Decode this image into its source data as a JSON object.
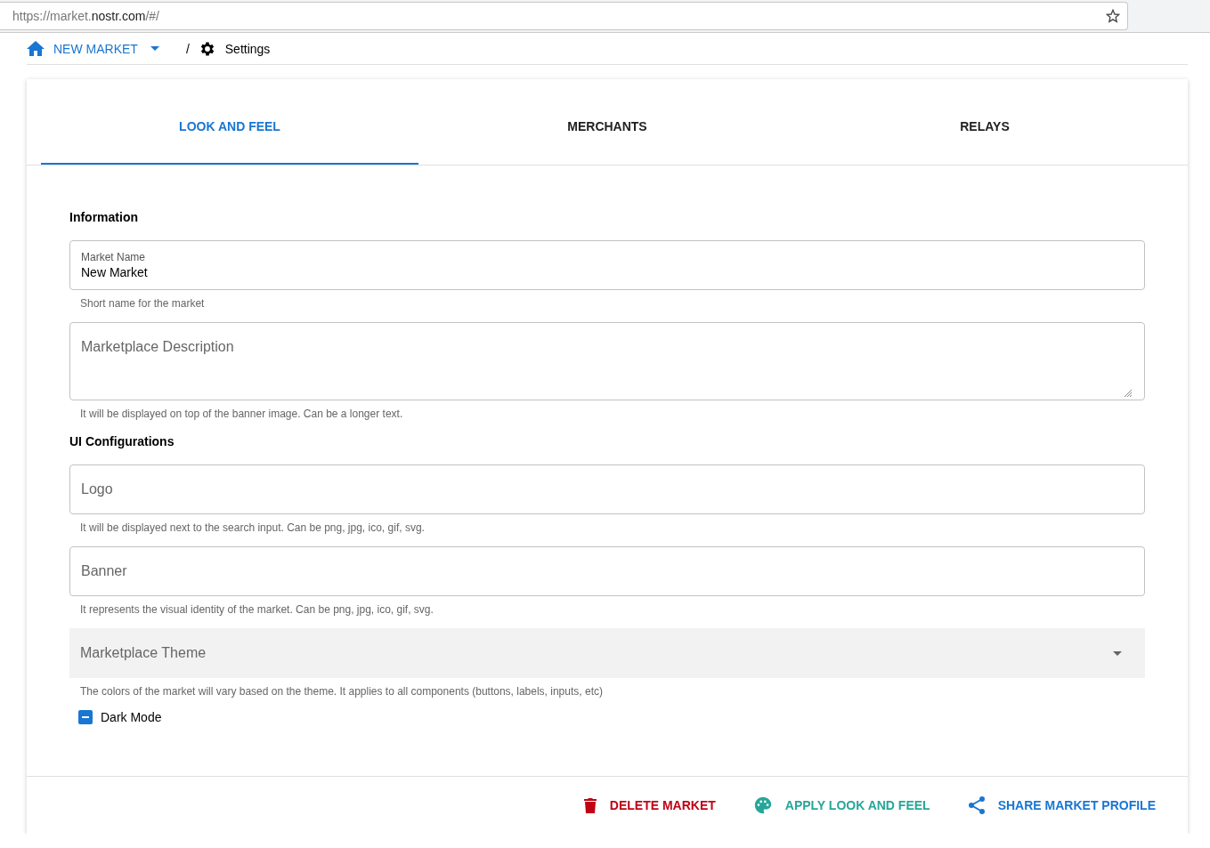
{
  "browser": {
    "url_prefix": "https://market.",
    "url_domain": "nostr.com",
    "url_suffix": "/#/"
  },
  "breadcrumb": {
    "market": "NEW MARKET",
    "separator": "/",
    "page": "Settings"
  },
  "tabs": [
    {
      "label": "LOOK AND FEEL",
      "selected": true
    },
    {
      "label": "MERCHANTS",
      "selected": false
    },
    {
      "label": "RELAYS",
      "selected": false
    }
  ],
  "sections": [
    {
      "title": "Information",
      "fields": [
        {
          "kind": "text",
          "label": "Market Name",
          "value": "New Market",
          "hint": "Short name for the market"
        },
        {
          "kind": "textarea",
          "placeholder": "Marketplace Description",
          "hint": "It will be displayed on top of the banner image. Can be a longer text."
        }
      ]
    },
    {
      "title": "UI Configurations",
      "fields": [
        {
          "kind": "text",
          "placeholder": "Logo",
          "hint": "It will be displayed next to the search input. Can be png, jpg, ico, gif, svg."
        },
        {
          "kind": "text",
          "placeholder": "Banner",
          "hint": "It represents the visual identity of the market. Can be png, jpg, ico, gif, svg."
        },
        {
          "kind": "select",
          "placeholder": "Marketplace Theme",
          "hint": "The colors of the market will vary based on the theme. It applies to all components (buttons, labels, inputs, etc)"
        },
        {
          "kind": "checkbox",
          "label": "Dark Mode",
          "indeterminate": true
        }
      ]
    }
  ],
  "actions": [
    {
      "kind": "delete",
      "label": "DELETE MARKET",
      "color": "#c10015"
    },
    {
      "kind": "palette",
      "label": "APPLY LOOK AND FEEL",
      "color": "#26a69a"
    },
    {
      "kind": "share",
      "label": "SHARE MARKET PROFILE",
      "color": "#1976d2"
    }
  ]
}
